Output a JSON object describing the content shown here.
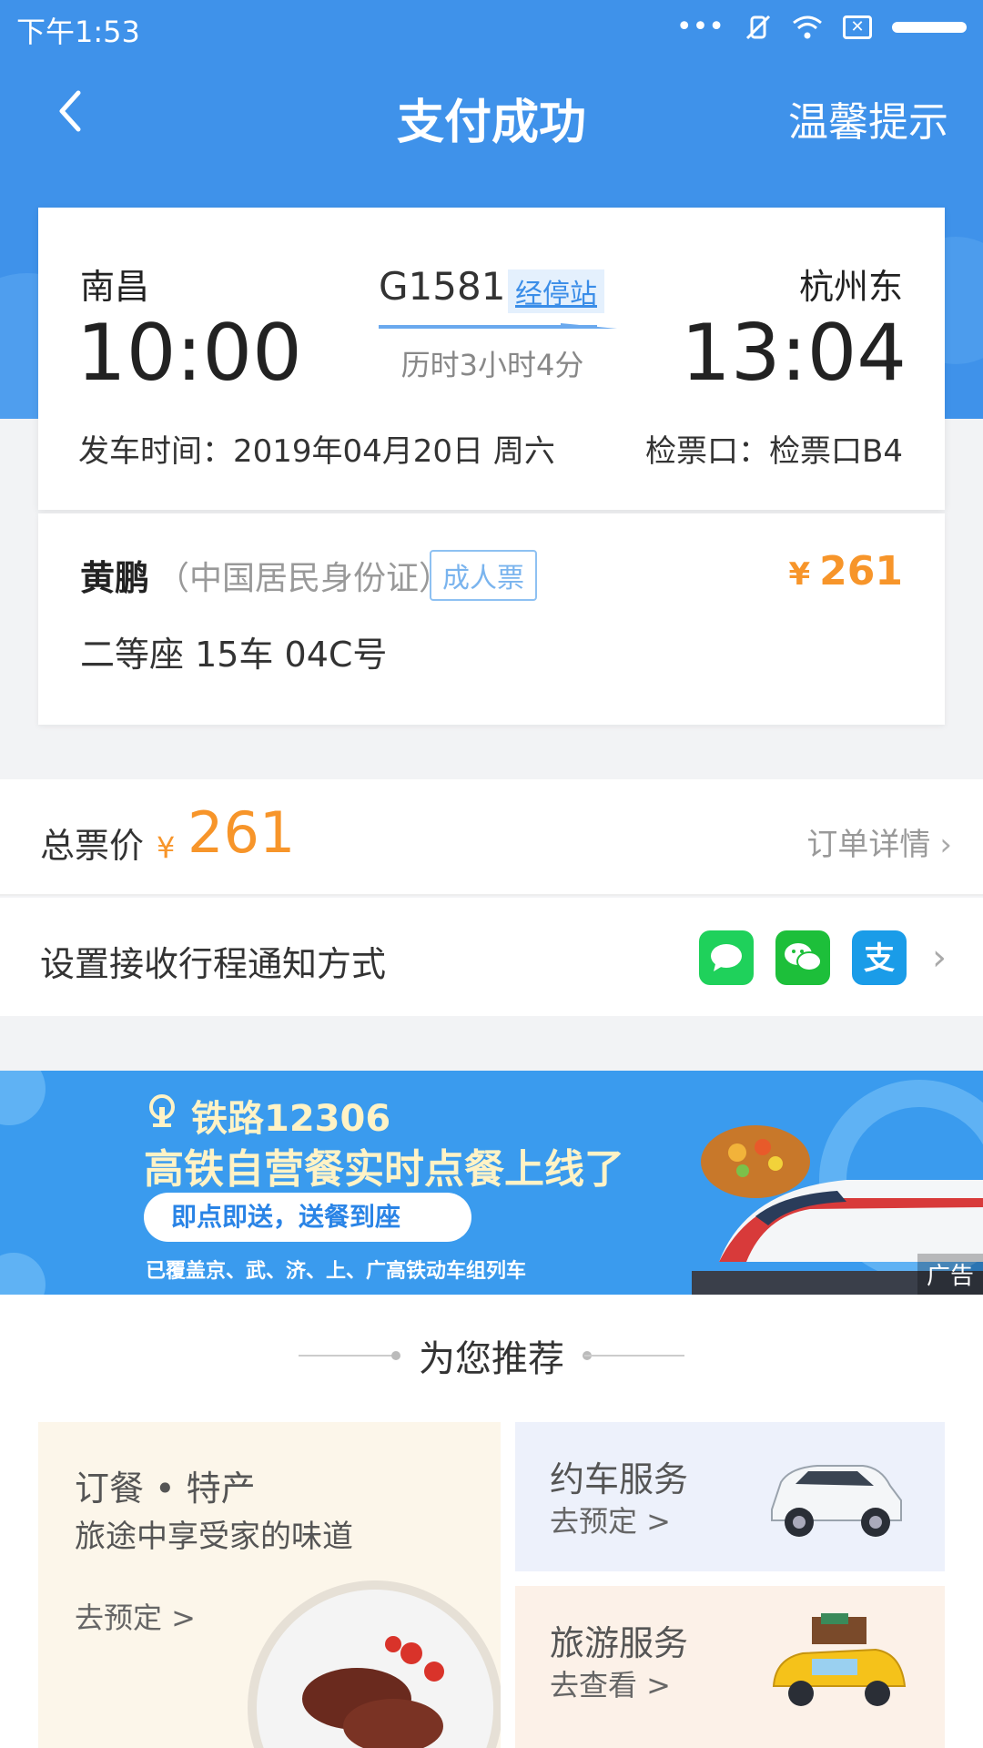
{
  "status_bar": {
    "time": "下午1:53",
    "dots": "•••"
  },
  "nav": {
    "title": "支付成功",
    "tip": "温馨提示"
  },
  "ticket": {
    "from_station": "南昌",
    "from_time": "10:00",
    "to_station": "杭州东",
    "to_time": "13:04",
    "train_no": "G1581",
    "stops_link": "经停站",
    "duration": "历时3小时4分",
    "depart_date": "发车时间：2019年04月20日 周六",
    "gate": "检票口：检票口B4"
  },
  "passenger": {
    "name": "黄鹏",
    "id_type": "（中国居民身份证）",
    "ticket_type": "成人票",
    "currency": "¥",
    "price": "261",
    "seat": "二等座 15车 04C号"
  },
  "total": {
    "label": "总票价",
    "currency": "¥",
    "value": "261",
    "order_detail": "订单详情"
  },
  "notify": {
    "label": "设置接收行程通知方式",
    "icons": [
      "sms-icon",
      "wechat-icon",
      "alipay-icon"
    ]
  },
  "banner": {
    "brand": "铁路12306",
    "headline": "高铁自营餐实时点餐上线了",
    "pill": "即点即送，送餐到座",
    "sub": "已覆盖京、武、济、上、广高铁动车组列车",
    "ad": "广告"
  },
  "recommend": {
    "title": "为您推荐",
    "food": {
      "title": "订餐 • 特产",
      "subtitle": "旅途中享受家的味道",
      "link": "去预定 >"
    },
    "car": {
      "title": "约车服务",
      "link": "去预定 >"
    },
    "tour": {
      "title": "旅游服务",
      "link": "去查看 >"
    }
  },
  "colors": {
    "header_blue": "#3f92ea",
    "price_orange": "#f7952a",
    "link_blue": "#3a8de8"
  }
}
